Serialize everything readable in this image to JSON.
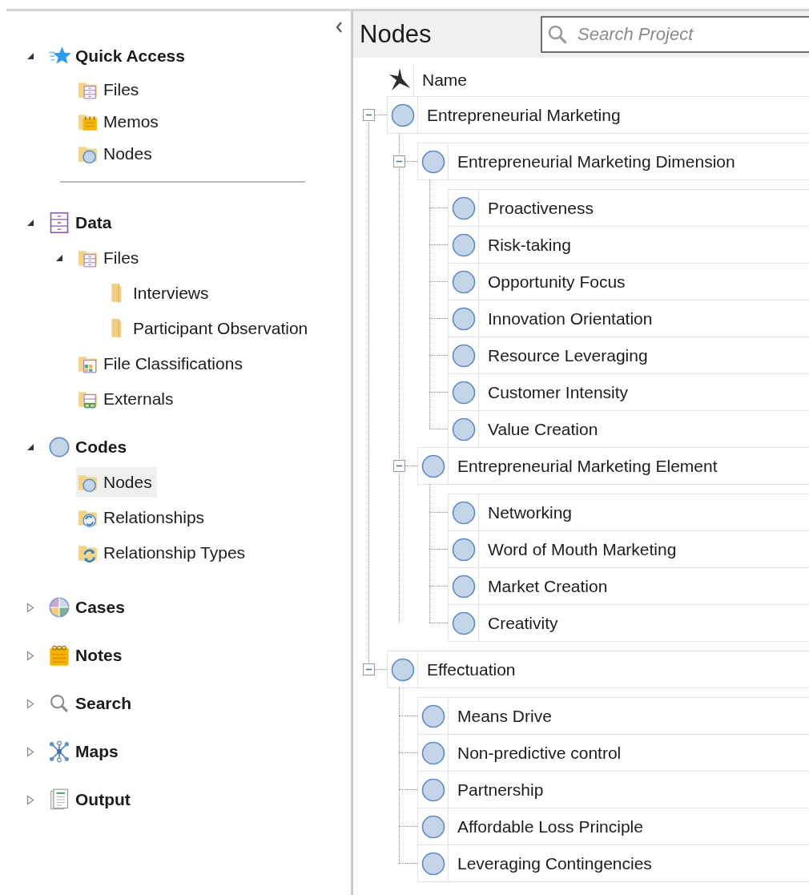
{
  "sidebar": {
    "sections": [
      {
        "kind": "quick-access",
        "label": "Quick Access",
        "expanded": true,
        "selected": false,
        "items": [
          {
            "kind": "files",
            "label": "Files",
            "selected": false
          },
          {
            "kind": "memos",
            "label": "Memos",
            "selected": false
          },
          {
            "kind": "nodes",
            "label": "Nodes",
            "selected": false
          }
        ]
      },
      {
        "kind": "data",
        "label": "Data",
        "expanded": true,
        "selected": false,
        "items": [
          {
            "kind": "files",
            "label": "Files",
            "selected": false,
            "expanded": true,
            "children": [
              {
                "kind": "folder",
                "label": "Interviews",
                "selected": false
              },
              {
                "kind": "folder",
                "label": "Participant Observation",
                "selected": false
              }
            ]
          },
          {
            "kind": "classifications",
            "label": "File Classifications",
            "selected": false
          },
          {
            "kind": "externals",
            "label": "Externals",
            "selected": false
          }
        ]
      },
      {
        "kind": "codes",
        "label": "Codes",
        "expanded": true,
        "selected": false,
        "items": [
          {
            "kind": "nodes",
            "label": "Nodes",
            "selected": true
          },
          {
            "kind": "relationships",
            "label": "Relationships",
            "selected": false
          },
          {
            "kind": "relationship-types",
            "label": "Relationship Types",
            "selected": false
          }
        ]
      },
      {
        "kind": "cases",
        "label": "Cases",
        "expanded": false,
        "selected": false
      },
      {
        "kind": "notes",
        "label": "Notes",
        "expanded": false,
        "selected": false
      },
      {
        "kind": "search",
        "label": "Search",
        "expanded": false,
        "selected": false
      },
      {
        "kind": "maps",
        "label": "Maps",
        "expanded": false,
        "selected": false
      },
      {
        "kind": "output",
        "label": "Output",
        "expanded": false,
        "selected": false
      }
    ]
  },
  "nodes_pane": {
    "title": "Nodes",
    "search": {
      "placeholder": "Search Project"
    },
    "columns": [
      "Name"
    ],
    "nodes": [
      {
        "label": "Entrepreneurial Marketing",
        "selected": false,
        "expanded": true,
        "children": [
          {
            "label": "Entrepreneurial Marketing Dimension",
            "selected": false,
            "expanded": true,
            "children": [
              {
                "label": "Proactiveness",
                "selected": false
              },
              {
                "label": "Risk-taking",
                "selected": false
              },
              {
                "label": "Opportunity Focus",
                "selected": false
              },
              {
                "label": "Innovation Orientation",
                "selected": false
              },
              {
                "label": "Resource Leveraging",
                "selected": false
              },
              {
                "label": "Customer Intensity",
                "selected": false
              },
              {
                "label": "Value Creation",
                "selected": false
              }
            ]
          },
          {
            "label": "Entrepreneurial Marketing Element",
            "selected": false,
            "expanded": true,
            "children": [
              {
                "label": "Networking",
                "selected": false
              },
              {
                "label": "Word of Mouth Marketing",
                "selected": false
              },
              {
                "label": "Market Creation",
                "selected": false
              },
              {
                "label": "Creativity",
                "selected": false
              }
            ]
          }
        ]
      },
      {
        "label": "Effectuation",
        "selected": false,
        "expanded": true,
        "children": [
          {
            "label": "Means Drive",
            "selected": false
          },
          {
            "label": "Non-predictive control",
            "selected": false
          },
          {
            "label": "Partnership",
            "selected": false
          },
          {
            "label": "Affordable Loss Principle",
            "selected": false
          },
          {
            "label": "Leveraging Contingencies",
            "selected": false
          }
        ]
      }
    ]
  }
}
